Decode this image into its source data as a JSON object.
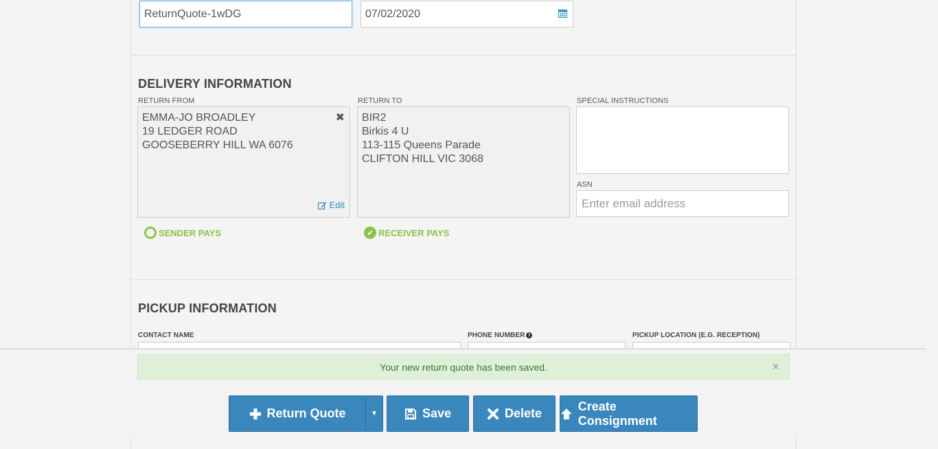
{
  "top": {
    "reference_value": "ReturnQuote-1wDG",
    "date_value": "07/02/2020",
    "date_icon": "calendar-icon"
  },
  "delivery": {
    "title": "DELIVERY INFORMATION",
    "return_from": {
      "label": "RETURN FROM",
      "lines": [
        "EMMA-JO BROADLEY",
        "19 LEDGER ROAD",
        "GOOSEBERRY HILL WA 6076"
      ],
      "close_icon": "close-icon",
      "edit_label": "Edit"
    },
    "return_to": {
      "label": "RETURN TO",
      "lines": [
        "BIR2",
        "Birkis 4 U",
        "113-115 Queens Parade",
        "CLIFTON HILL VIC 3068"
      ]
    },
    "special_instructions": {
      "label": "SPECIAL INSTRUCTIONS"
    },
    "asn": {
      "label": "ASN",
      "placeholder": "Enter email address"
    },
    "payment": {
      "sender_pays": "SENDER PAYS",
      "receiver_pays": "RECEIVER PAYS",
      "selected": "RECEIVER PAYS"
    }
  },
  "pickup": {
    "title": "PICKUP INFORMATION",
    "contact_name_label": "CONTACT NAME",
    "phone_number_label": "PHONE NUMBER",
    "pickup_location_label": "PICKUP LOCATION (E.G. RECEPTION)"
  },
  "alert": {
    "message": "Your new return quote has been saved.",
    "dismiss": "×"
  },
  "actions": {
    "return_quote": "Return Quote",
    "save": "Save",
    "delete": "Delete",
    "create_consignment": "Create Consignment"
  },
  "colors": {
    "primary": "#3a87bd",
    "success": "#8bc34a",
    "alert_bg": "#dff0d8",
    "link": "#2a8fc7"
  }
}
